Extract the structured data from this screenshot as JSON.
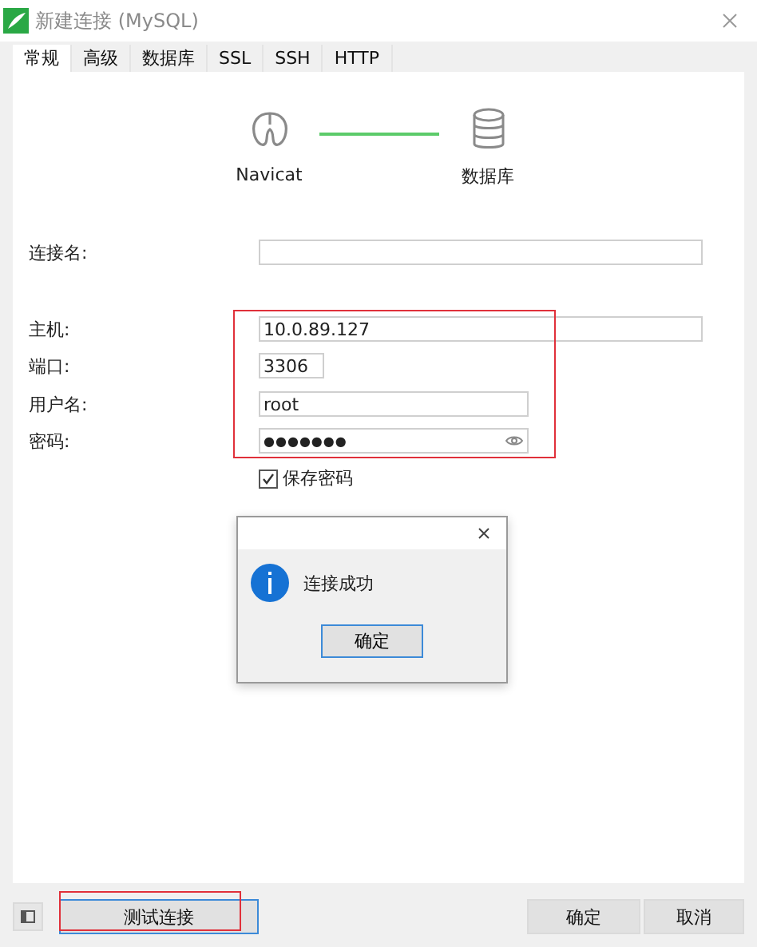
{
  "window": {
    "title": "新建连接 (MySQL)"
  },
  "tabs": [
    {
      "label": "常规",
      "selected": true
    },
    {
      "label": "高级",
      "selected": false
    },
    {
      "label": "数据库",
      "selected": false
    },
    {
      "label": "SSL",
      "selected": false
    },
    {
      "label": "SSH",
      "selected": false
    },
    {
      "label": "HTTP",
      "selected": false
    }
  ],
  "diagram": {
    "left_label": "Navicat",
    "right_label": "数据库"
  },
  "fields": [
    {
      "label": "连接名:",
      "kind": "text"
    },
    {
      "label": "主机:",
      "value": "10.0.89.127",
      "kind": "text"
    },
    {
      "label": "端口:",
      "value": "3306",
      "kind": "text"
    },
    {
      "label": "用户名:",
      "value": "root",
      "kind": "text"
    },
    {
      "label": "密码:",
      "value": "●●●●●●●",
      "kind": "password"
    }
  ],
  "save_password": {
    "label": "保存密码",
    "checked": true
  },
  "highlight": {
    "fields": true,
    "test_button": true
  },
  "dialog": {
    "message": "连接成功",
    "button": "确定"
  },
  "footer": {
    "test_button": "测试连接",
    "ok_button": "确定",
    "cancel_button": "取消"
  }
}
